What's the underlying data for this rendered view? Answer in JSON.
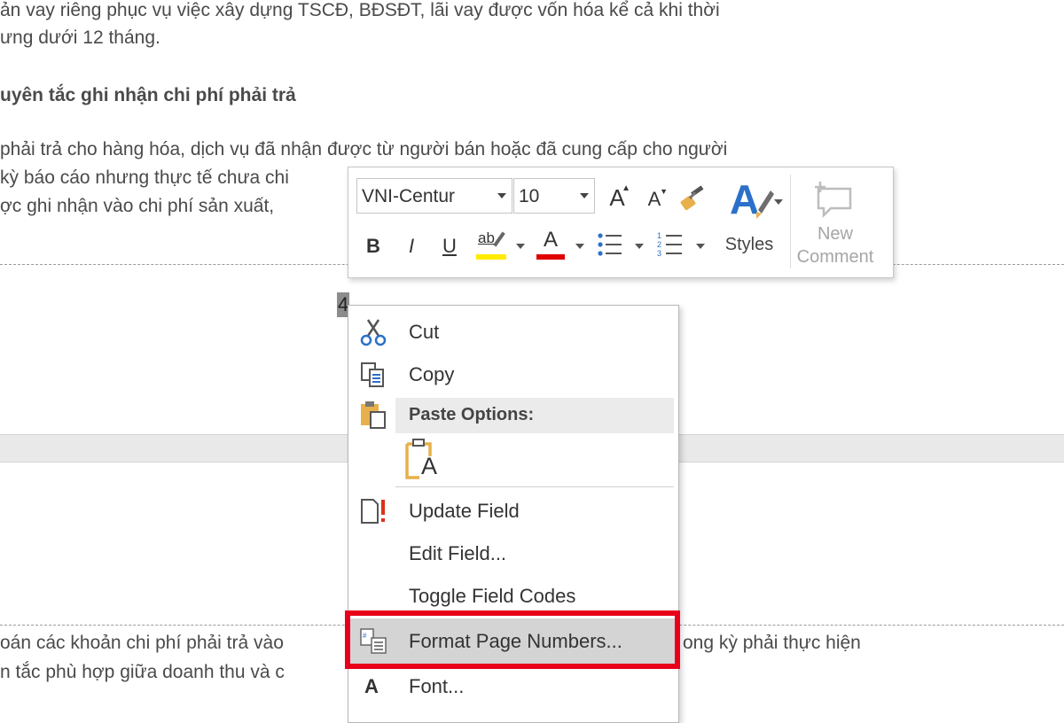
{
  "document": {
    "lines": [
      "ản vay riêng phục vụ việc xây dựng TSCĐ, BĐSĐT, lãi vay được vốn hóa kể cả khi thời",
      "ưng dưới 12 tháng.",
      "uyên tắc ghi nhận chi phí phải trả",
      "phải trả cho hàng hóa, dịch vụ đã nhận được từ người bán hoặc đã cung cấp cho người",
      "kỳ báo cáo nhưng thực tế chưa chi",
      "ợc ghi nhận vào chi phí sản xuất,",
      "oán các khoản chi phí phải trả vào",
      "ong kỳ phải thực hiện",
      "n tắc phù hợp giữa doanh thu và c"
    ],
    "page_number": "4"
  },
  "mini_toolbar": {
    "font_name": "VNI-Centur",
    "font_size": "10",
    "grow_font": "A",
    "shrink_font": "A",
    "bold": "B",
    "italic": "I",
    "underline": "U",
    "highlight": "ab",
    "font_color": "A",
    "styles_label": "Styles",
    "new_comment_line1": "New",
    "new_comment_line2": "Comment",
    "colors": {
      "highlight": "#ffeb00",
      "font_color": "#e00000",
      "styles_blue": "#2b70c9"
    }
  },
  "context_menu": {
    "cut": "Cut",
    "copy": "Copy",
    "paste_options": "Paste Options:",
    "paste_keep_text": "A",
    "update_field": "Update Field",
    "edit_field": "Edit Field...",
    "toggle_field_codes": "Toggle Field Codes",
    "format_page_numbers": "Format Page Numbers...",
    "font": "Font...",
    "font_icon": "A",
    "highlight_box_color": "#e8001a"
  }
}
